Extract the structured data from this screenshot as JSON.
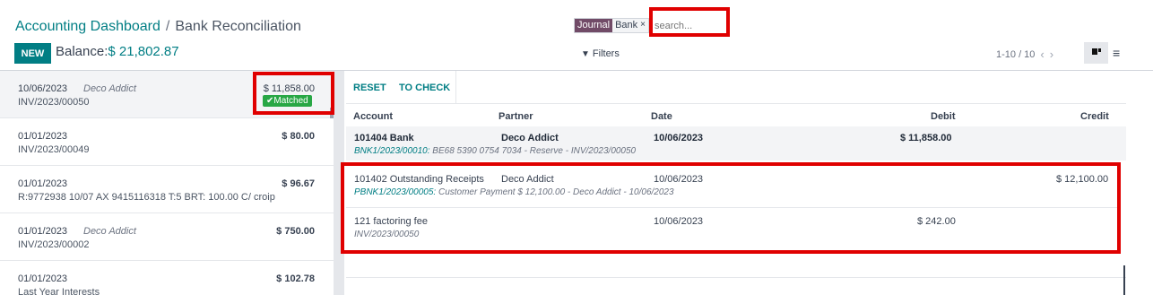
{
  "breadcrumb": {
    "parent": "Accounting Dashboard",
    "separator": "/",
    "current": "Bank Reconciliation"
  },
  "toolbar": {
    "new_label": "NEW",
    "balance_label": "Balance:",
    "balance_value": "$ 21,802.87"
  },
  "search": {
    "facet_type": "Journal",
    "facet_value": "Bank",
    "facet_remove": "×",
    "placeholder": "search..."
  },
  "filters_label": "Filters",
  "pager": {
    "range": "1-10 / 10",
    "prev": "‹",
    "next": "›"
  },
  "views": {
    "kanban_icon": "kanban-icon",
    "list_icon": "list-icon"
  },
  "statements": [
    {
      "date": "10/06/2023",
      "partner": "Deco Addict",
      "ref": "INV/2023/00050",
      "amount": "$ 11,858.00",
      "badge": "✔Matched"
    },
    {
      "date": "01/01/2023",
      "partner": "",
      "ref": "INV/2023/00049",
      "amount": "$ 80.00"
    },
    {
      "date": "01/01/2023",
      "partner": "",
      "ref": "R:9772938 10/07 AX 9415116318 T:5 BRT: 100.00 C/ croip",
      "amount": "$ 96.67"
    },
    {
      "date": "01/01/2023",
      "partner": "Deco Addict",
      "ref": "INV/2023/00002",
      "amount": "$ 750.00"
    },
    {
      "date": "01/01/2023",
      "partner": "",
      "ref": "Last Year Interests",
      "amount": "$ 102.78"
    }
  ],
  "actions": {
    "reset": "RESET",
    "to_check": "TO CHECK"
  },
  "columns": {
    "account": "Account",
    "partner": "Partner",
    "date": "Date",
    "debit": "Debit",
    "credit": "Credit"
  },
  "lines": [
    {
      "account": "101404 Bank",
      "partner": "Deco Addict",
      "date": "10/06/2023",
      "debit": "$ 11,858.00",
      "credit": "",
      "sub_link": "BNK1/2023/00010:",
      "sub_text": " BE68 5390 0754 7034 - Reserve - INV/2023/00050"
    },
    {
      "account": "101402 Outstanding Receipts",
      "partner": "Deco Addict",
      "date": "10/06/2023",
      "debit": "",
      "credit": "$ 12,100.00",
      "sub_link": "PBNK1/2023/00005:",
      "sub_text": " Customer Payment $ 12,100.00 - Deco Addict - 10/06/2023"
    },
    {
      "account": "121 factoring fee",
      "partner": "",
      "date": "10/06/2023",
      "debit": "$ 242.00",
      "credit": "",
      "sub_link": "",
      "sub_text": "INV/2023/00050"
    }
  ],
  "colors": {
    "primary": "#017e84",
    "journal_facet": "#714b67",
    "matched": "#28a745",
    "highlight": "#e00000"
  }
}
